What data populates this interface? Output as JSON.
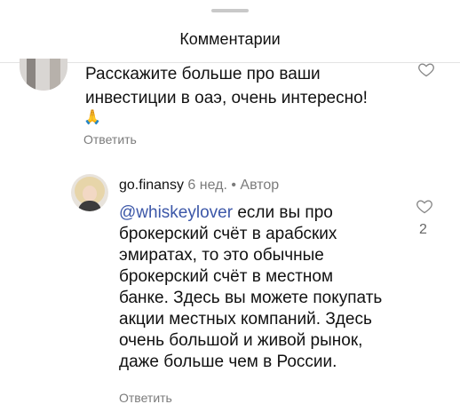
{
  "header": {
    "title": "Комментарии"
  },
  "comment1": {
    "text": "Расскажите больше про ваши инвестиции в оаэ, очень интересно!",
    "emoji": "🙏",
    "reply_label": "Ответить"
  },
  "comment2": {
    "username": "go.finansy",
    "time": "6 нед.",
    "separator": "•",
    "author_badge": "Автор",
    "mention": "@whiskeylover",
    "text": " если вы про брокерский счёт в арабских эмиратах, то это обычные брокерский счёт в местном банке. Здесь вы можете покупать акции местных компаний. Здесь очень большой и живой рынок, даже больше чем в России.",
    "like_count": "2",
    "reply_label": "Ответить"
  },
  "colors": {
    "mention": "#3c57a8",
    "secondary_text": "#7b7b7b"
  },
  "icons": {
    "like": "heart-icon"
  }
}
